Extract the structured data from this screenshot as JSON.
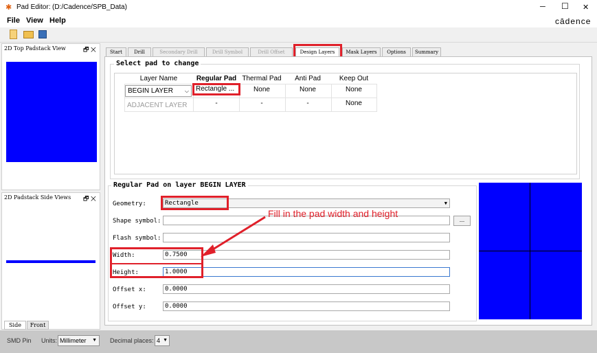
{
  "window": {
    "title": "Pad Editor:",
    "path": "(D:/Cadence/SPB_Data)",
    "minimize": "─",
    "maximize": "☐",
    "close": "✕"
  },
  "menu": {
    "file": "File",
    "view": "View",
    "help": "Help"
  },
  "brand": "cādence",
  "panels": {
    "top_view": "2D Top Padstack View",
    "side_view": "2D Padstack Side Views",
    "pin_glyph": "🗗 ✕",
    "side_tabs": [
      "Side",
      "Front"
    ]
  },
  "tabs": [
    "Start",
    "Drill",
    "Secondary Drill",
    "Drill Symbol",
    "Drill Offset",
    "Design Layers",
    "Mask Layers",
    "Options",
    "Summary"
  ],
  "select_group": {
    "title": "Select pad to change",
    "headers": [
      "Layer Name",
      "Regular Pad",
      "Thermal Pad",
      "Anti Pad",
      "Keep Out"
    ],
    "row1": {
      "layer": "BEGIN LAYER",
      "regular": "Rectangle ...",
      "thermal": "None",
      "anti": "None",
      "keepout": "None"
    },
    "row2": {
      "layer": "ADJACENT LAYER",
      "regular": "-",
      "thermal": "-",
      "anti": "-",
      "keepout": "None"
    }
  },
  "pad_group": {
    "title": "Regular Pad on layer BEGIN LAYER",
    "geometry_label": "Geometry:",
    "geometry_value": "Rectangle",
    "shape_label": "Shape symbol:",
    "shape_browse": "...",
    "flash_label": "Flash symbol:",
    "width_label": "Width:",
    "width_value": "0.7500",
    "height_label": "Height:",
    "height_value": "1.0000",
    "offx_label": "Offset x:",
    "offx_value": "0.0000",
    "offy_label": "Offset y:",
    "offy_value": "0.0000"
  },
  "annotation": "Fill in the pad width and height",
  "status": {
    "mode": "SMD Pin",
    "units_label": "Units:",
    "units_value": "Millimeter",
    "decimal_label": "Decimal places:",
    "decimal_value": "4"
  },
  "colors": {
    "pad_fill": "#0000ff",
    "highlight": "#e0202a"
  }
}
